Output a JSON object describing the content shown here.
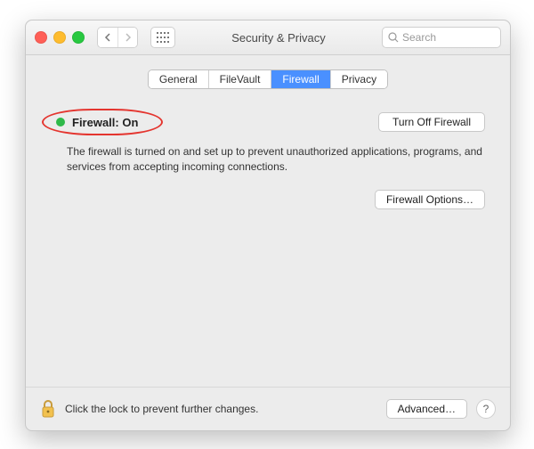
{
  "window": {
    "title": "Security & Privacy",
    "search_placeholder": "Search"
  },
  "tabs": [
    "General",
    "FileVault",
    "Firewall",
    "Privacy"
  ],
  "active_tab_index": 2,
  "main": {
    "status_label": "Firewall: On",
    "status_color": "#2fb94a",
    "turn_off_button": "Turn Off Firewall",
    "description": "The firewall is turned on and set up to prevent unauthorized applications, programs, and services from accepting incoming connections.",
    "options_button": "Firewall Options…"
  },
  "footer": {
    "lock_text": "Click the lock to prevent further changes.",
    "advanced_button": "Advanced…",
    "help_glyph": "?"
  },
  "annotation": {
    "highlight_ellipse": true,
    "highlight_color": "#e4352f"
  }
}
